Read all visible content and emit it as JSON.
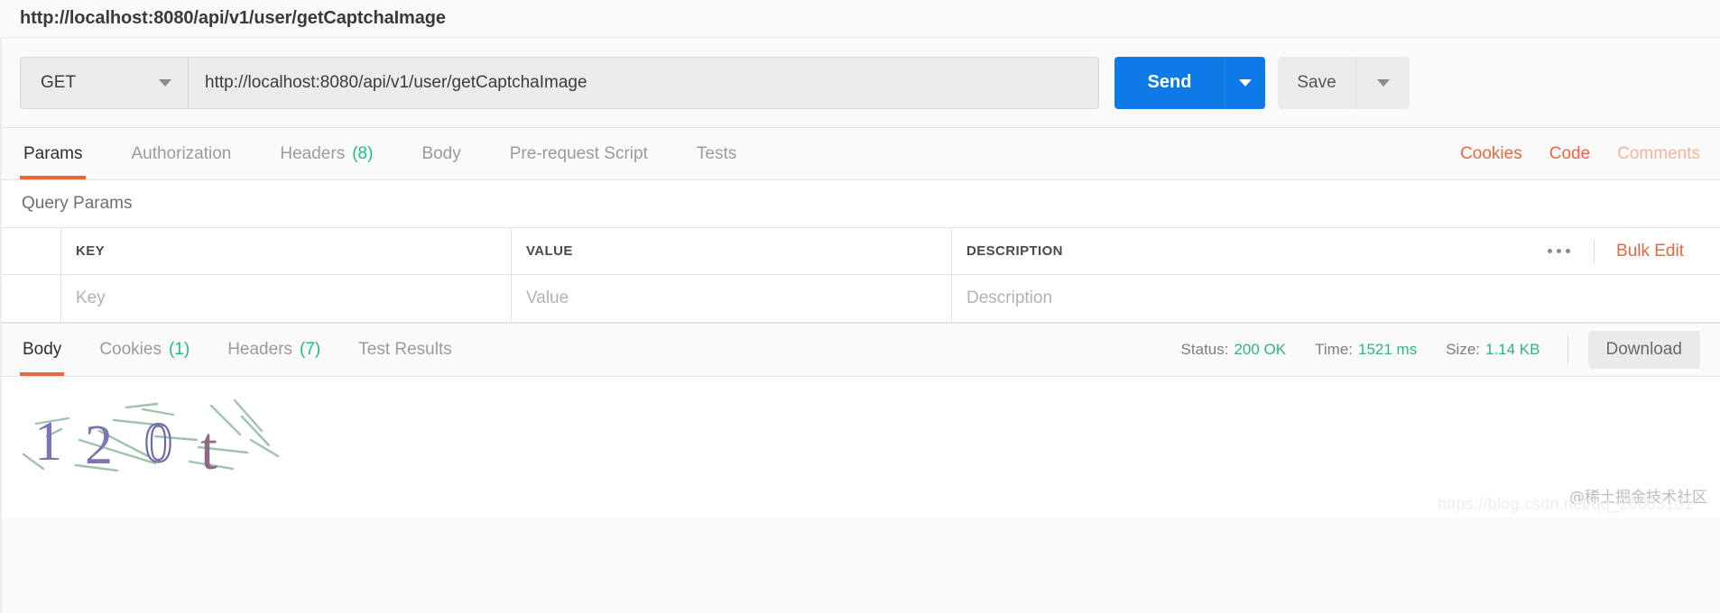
{
  "window": {
    "title": "http://localhost:8080/api/v1/user/getCaptchaImage"
  },
  "request": {
    "method": "GET",
    "method_caret_icon": "chevron-down-icon",
    "url": "http://localhost:8080/api/v1/user/getCaptchaImage",
    "url_placeholder": "Enter request URL",
    "send_label": "Send",
    "send_caret_icon": "chevron-down-icon",
    "save_label": "Save",
    "save_caret_icon": "chevron-down-icon"
  },
  "request_tabs": [
    {
      "label": "Params",
      "count": "",
      "active": true
    },
    {
      "label": "Authorization",
      "count": "",
      "active": false
    },
    {
      "label": "Headers",
      "count": "(8)",
      "active": false
    },
    {
      "label": "Body",
      "count": "",
      "active": false
    },
    {
      "label": "Pre-request Script",
      "count": "",
      "active": false
    },
    {
      "label": "Tests",
      "count": "",
      "active": false
    }
  ],
  "request_tab_actions": [
    {
      "label": "Cookies",
      "muted": false
    },
    {
      "label": "Code",
      "muted": false
    },
    {
      "label": "Comments",
      "muted": true
    }
  ],
  "query_params": {
    "section_title": "Query Params",
    "columns": [
      "KEY",
      "VALUE",
      "DESCRIPTION"
    ],
    "more_icon": "ellipsis-icon",
    "bulk_edit_label": "Bulk Edit",
    "rows": [
      {
        "key": "",
        "value": "",
        "description": "",
        "key_placeholder": "Key",
        "value_placeholder": "Value",
        "description_placeholder": "Description"
      }
    ]
  },
  "response_tabs": [
    {
      "label": "Body",
      "count": "",
      "active": true
    },
    {
      "label": "Cookies",
      "count": "(1)",
      "active": false
    },
    {
      "label": "Headers",
      "count": "(7)",
      "active": false
    },
    {
      "label": "Test Results",
      "count": "",
      "active": false
    }
  ],
  "response_meta": {
    "status_label": "Status:",
    "status_value": "200 OK",
    "time_label": "Time:",
    "time_value": "1521 ms",
    "size_label": "Size:",
    "size_value": "1.14 KB",
    "download_label": "Download"
  },
  "response_body": {
    "type": "captcha-image",
    "characters": [
      "1",
      "2",
      "0",
      "t"
    ],
    "text": "120t"
  },
  "watermark": {
    "cn": "@稀土掘金技术社区",
    "url": "https://blog.csdn.net/qq_26003101"
  },
  "colors": {
    "accent_orange": "#e8673c",
    "send_blue": "#0d7ae5",
    "status_green": "#2eb67d",
    "captcha_purple": "#7b75b4",
    "captcha_noise": "#9fc3ac"
  }
}
